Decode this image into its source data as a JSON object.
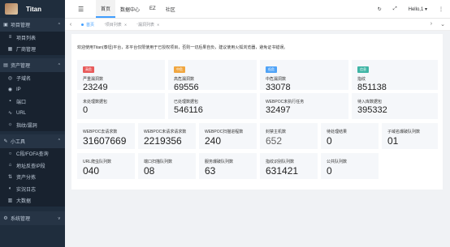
{
  "brand": {
    "name": "Titan"
  },
  "sidebar": {
    "groups": [
      {
        "label": "项目管理",
        "icon": "folder-icon",
        "items": [
          {
            "label": "项目列表",
            "icon": "list-icon"
          },
          {
            "label": "厂商管理",
            "icon": "building-icon"
          }
        ]
      },
      {
        "label": "资产管理",
        "icon": "database-icon",
        "items": [
          {
            "label": "子域名",
            "icon": "globe-icon"
          },
          {
            "label": "IP",
            "icon": "location-icon"
          },
          {
            "label": "端口",
            "icon": "port-icon"
          },
          {
            "label": "URL",
            "icon": "link-icon"
          },
          {
            "label": "指纹/漏洞",
            "icon": "fingerprint-icon"
          }
        ]
      },
      {
        "label": "小工具",
        "icon": "tools-icon",
        "items": [
          {
            "label": "C段/FOFA查询",
            "icon": "search-icon"
          },
          {
            "label": "地址反查IP段",
            "icon": "map-icon"
          },
          {
            "label": "资产分拣",
            "icon": "sort-icon"
          },
          {
            "label": "实況日志",
            "icon": "log-icon"
          },
          {
            "label": "大数据",
            "icon": "chart-icon"
          }
        ]
      },
      {
        "label": "系统管理",
        "icon": "settings-icon",
        "items": []
      }
    ]
  },
  "topbar": {
    "menus": [
      "首页",
      "数据中心",
      "EZ",
      "社区"
    ],
    "active_menu": 0,
    "user": "Hello,1"
  },
  "tabs": [
    {
      "label": "首页",
      "active": true
    },
    {
      "label": "项目列表",
      "active": false
    },
    {
      "label": "漏洞列表",
      "active": false
    }
  ],
  "notice": "欢迎使用Titan(泰坦)平台，本平台仅限使用于已授权项目，否则一切后果自负，建议使用火狐浏览器，避免证书错误。",
  "severity_cards": [
    {
      "badge": "高危",
      "badge_color": "#e85b5b",
      "label": "严重漏洞数",
      "value": "23249"
    },
    {
      "badge": "中危",
      "badge_color": "#f0a640",
      "label": "高危漏洞数",
      "value": "69556"
    },
    {
      "badge": "低危",
      "badge_color": "#4fa3f7",
      "label": "中危漏洞数",
      "value": "33078"
    },
    {
      "badge": "信息",
      "badge_color": "#3fb5a5",
      "label": "指纹",
      "value": "851138"
    }
  ],
  "stat_row2": [
    {
      "label": "未处理数据包",
      "value": "0"
    },
    {
      "label": "已处理数据包",
      "value": "546116"
    },
    {
      "label": "WEBPOC未执行任务",
      "value": "32497"
    },
    {
      "label": "待入库数据包",
      "value": "395332"
    }
  ],
  "stat_row3": [
    {
      "label": "WEBPOC去请求数",
      "value": "31607669"
    },
    {
      "label": "WEBPOC未请求请求数",
      "value": "2219356"
    },
    {
      "label": "WEBPOC扫描进程数",
      "value": "240"
    },
    {
      "label": "封禁主机数",
      "value": "652"
    },
    {
      "label": "待处理结果",
      "value": "0"
    },
    {
      "label": "子域名爆破队列数",
      "value": "01"
    }
  ],
  "stat_row4": [
    {
      "label": "URL爬虫队列数",
      "value": "040"
    },
    {
      "label": "端口扫描队列数",
      "value": "08"
    },
    {
      "label": "服务爆破队列数",
      "value": "63"
    },
    {
      "label": "指纹识别队列数",
      "value": "631421"
    },
    {
      "label": "公共队列数",
      "value": "0"
    }
  ]
}
